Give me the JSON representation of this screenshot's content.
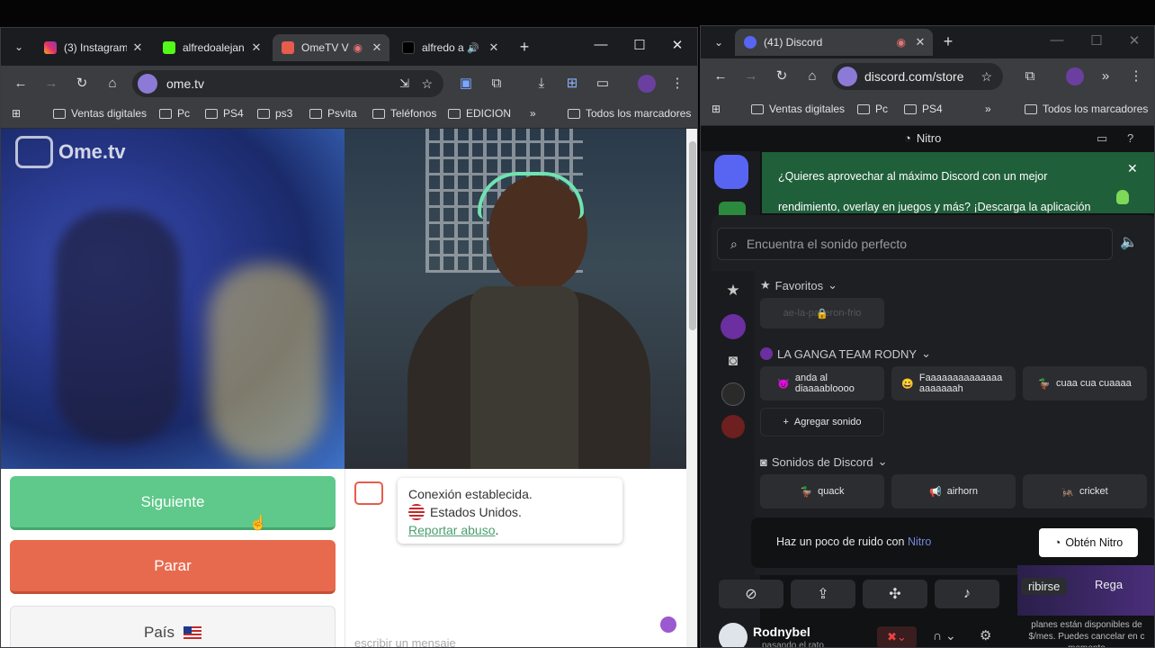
{
  "left_browser": {
    "tabs": [
      {
        "title": "(3) Instagram",
        "favicon": "instagram-icon",
        "color": "#e1306c"
      },
      {
        "title": "alfredoalejan",
        "favicon": "kick-icon",
        "color": "#53fc18"
      },
      {
        "title": "OmeTV V",
        "favicon": "ometv-icon",
        "color": "#e65c4d"
      },
      {
        "title": "alfredo a",
        "favicon": "tiktok-icon",
        "color": "#111111"
      }
    ],
    "url": "ome.tv",
    "bookmarks": [
      "Ventas digitales",
      "Pc",
      "PS4",
      "ps3",
      "Psvita",
      "Teléfonos",
      "EDICION"
    ],
    "all_bookmarks": "Todos los marcadores",
    "more": "»"
  },
  "ometv": {
    "logo": "Ome.tv",
    "buttons": {
      "next": "Siguiente",
      "stop": "Parar",
      "country": "País"
    },
    "colors": {
      "next": "#5ec98a",
      "stop": "#e86a4e"
    },
    "chat": {
      "connected": "Conexión establecida.",
      "country": "Estados Unidos.",
      "report": "Reportar abuso",
      "report_suffix": ".",
      "input_placeholder": "escribir un mensaje"
    }
  },
  "right_browser": {
    "tab_title": "(41) Discord",
    "url": "discord.com/store",
    "bookmarks": [
      "Ventas digitales",
      "Pc",
      "PS4"
    ],
    "all_bookmarks": "Todos los marcadores",
    "more": "»"
  },
  "discord": {
    "header": "Nitro",
    "banner": "¿Quieres aprovechar al máximo Discord con un mejor rendimiento, overlay en juegos y más? ¡Descarga la aplicación para escritorio!",
    "search_placeholder": "Encuentra el sonido perfecto",
    "favorites": {
      "title": "Favoritos",
      "item": "ae-la-patieron-frio"
    },
    "server_section": {
      "title": "LA GANGA TEAM RODNY",
      "sounds": [
        "anda al diaaaabloooo",
        "Faaaaaaaaaaaaaa aaaaaaah",
        "cuaa cua cuaaaa"
      ],
      "add": "Agregar sonido"
    },
    "discord_sounds": {
      "title": "Sonidos de Discord",
      "sounds": [
        "quack",
        "airhorn",
        "cricket"
      ]
    },
    "upsell": {
      "text": "Haz un poco de ruido con",
      "link": "Nitro",
      "button": "Obtén Nitro"
    },
    "bottom": {
      "username": "Rodnybel",
      "status": "pasando el rato",
      "side_text_1": "ribirse",
      "side_text_2": "Rega",
      "side_note": "planes están disponibles de $/mes. Puedes cancelar en c momento"
    },
    "accent": "#5865f2"
  }
}
